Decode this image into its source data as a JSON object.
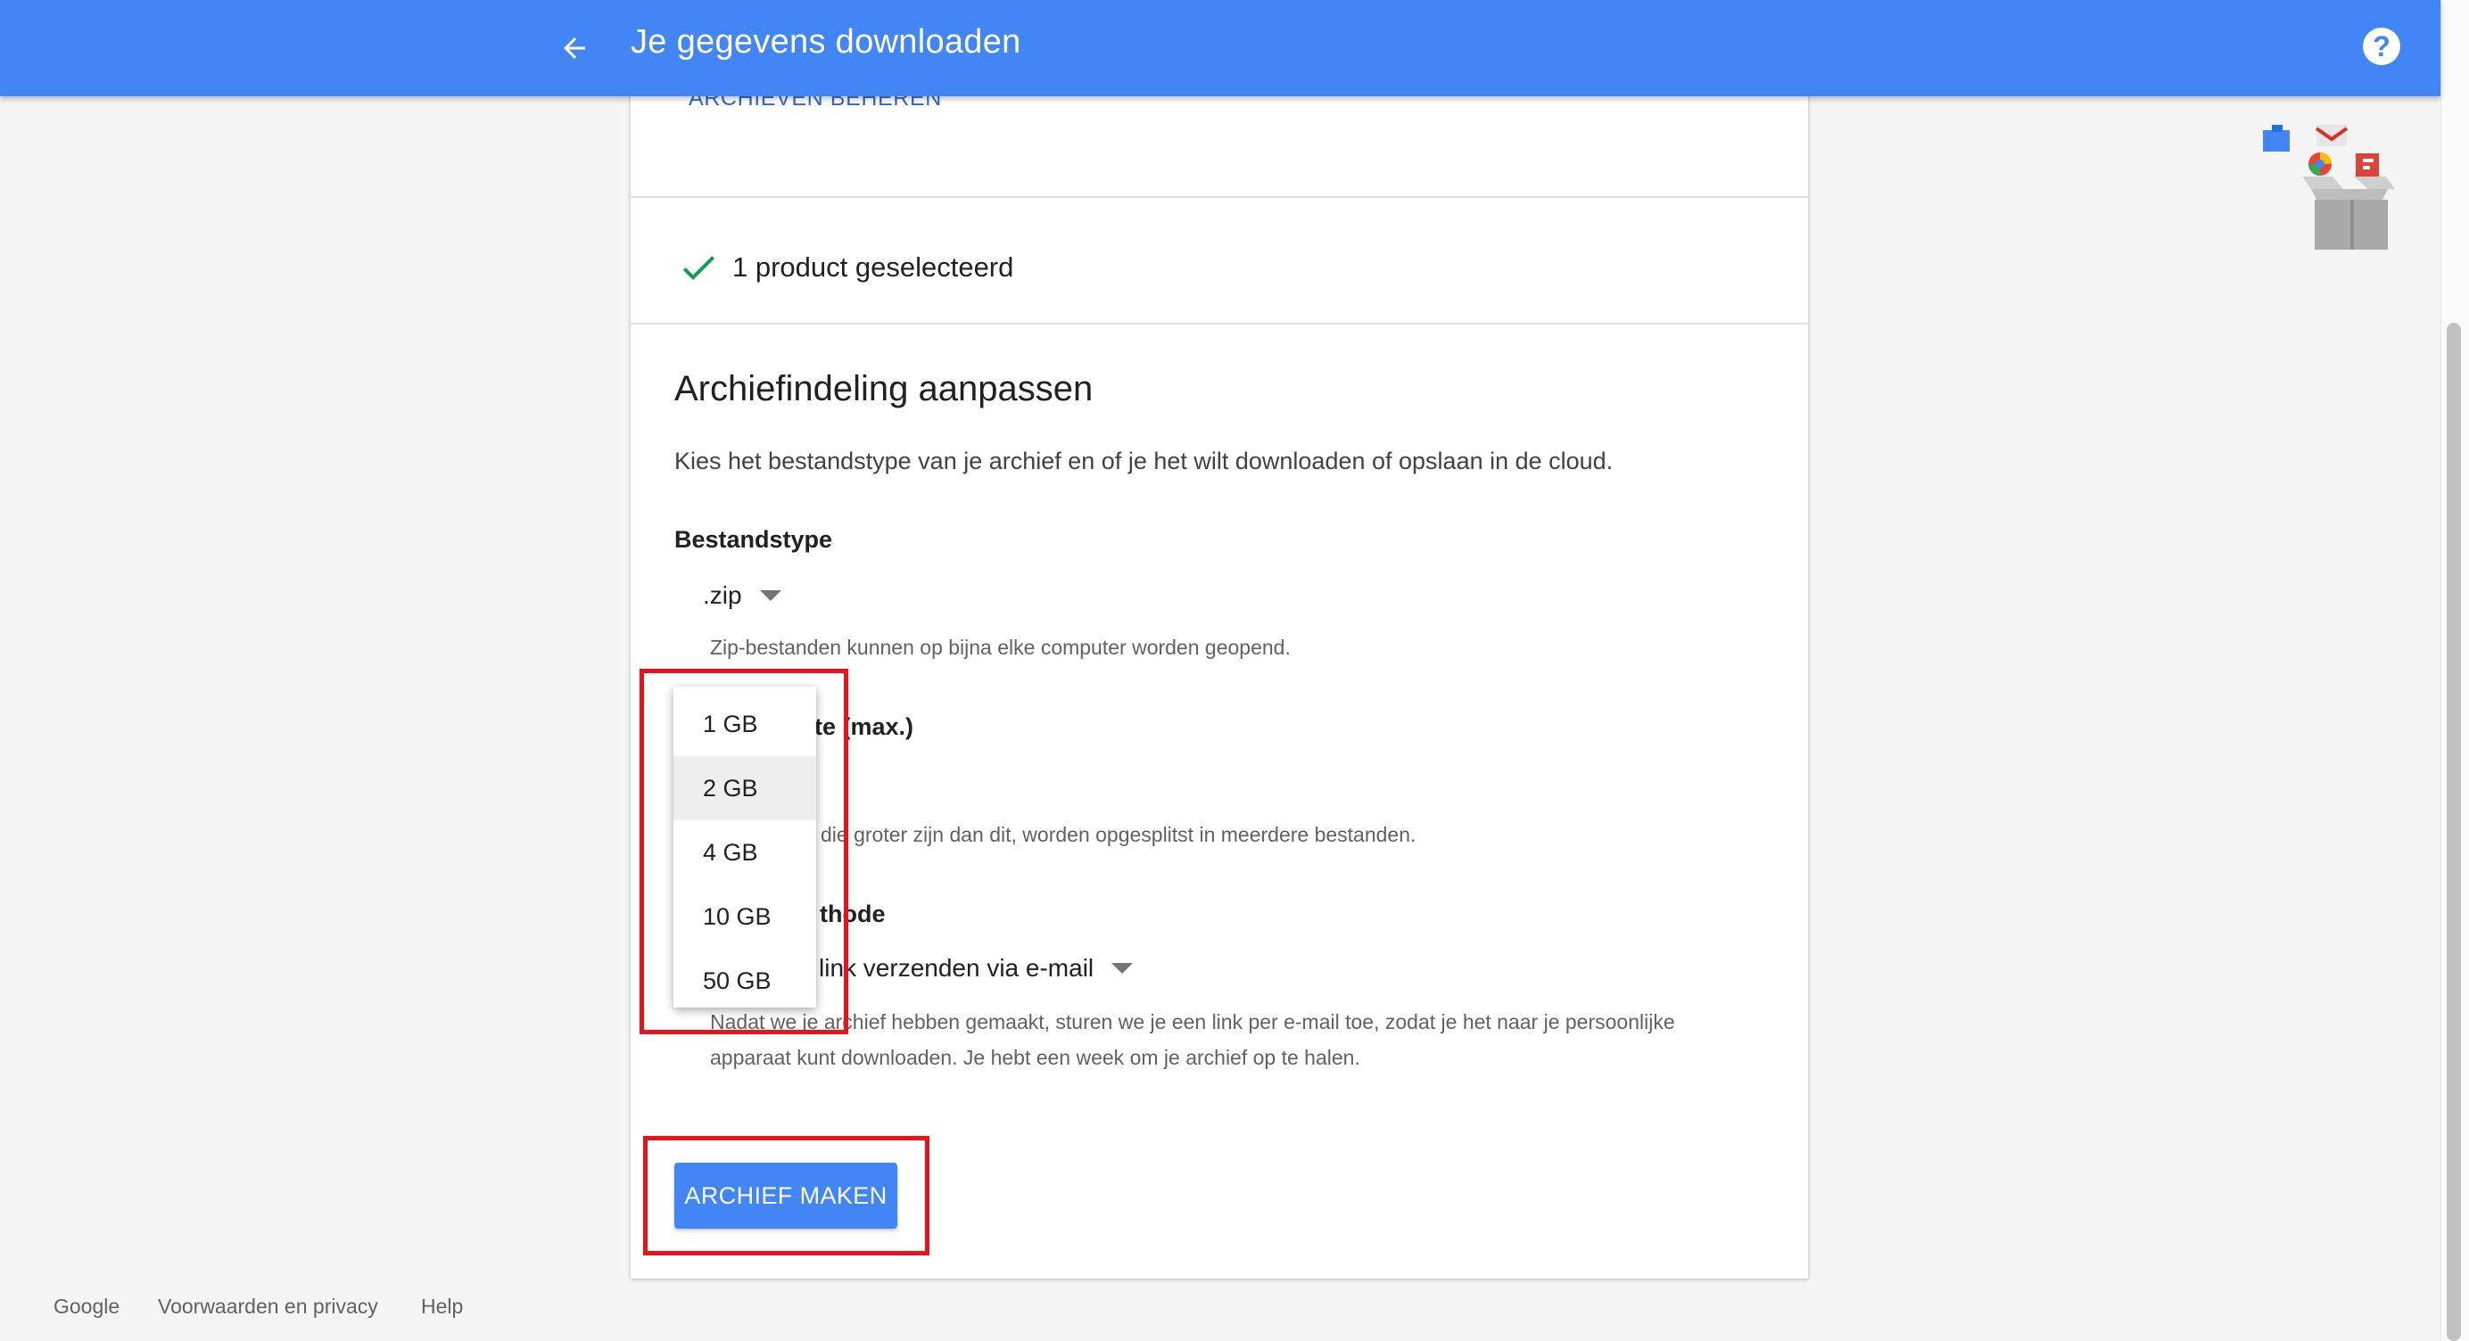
{
  "header": {
    "title": "Je gegevens downloaden",
    "back_icon": "arrow-back-icon",
    "help_icon": "help-icon",
    "help_glyph": "?",
    "background_color": "#4285f4"
  },
  "card": {
    "manage_archives_link": "ARCHIEVEN BEHEREN",
    "selected_products_text": "1 product geselecteerd",
    "section_title": "Archiefindeling aanpassen",
    "section_description": "Kies het bestandstype van je archief en of je het wilt downloaden of opslaan in de cloud.",
    "file_type": {
      "label": "Bestandstype",
      "value": ".zip",
      "helper": "Zip-bestanden kunnen op bijna elke computer worden geopend."
    },
    "archive_size": {
      "label_visible": "te (max.)",
      "helper_visible": "die groter zijn dan dit, worden opgesplitst in meerdere bestanden."
    },
    "delivery_method": {
      "label_visible": "thode",
      "value_visible": "link verzenden via e-mail",
      "helper_line1": "Nadat we je archief hebben gemaakt, sturen we je een link per e-mail toe, zodat je het naar je persoonlijke",
      "helper_line2": "apparaat kunt downloaden. Je hebt een week om je archief op te halen."
    },
    "create_button": "ARCHIEF MAKEN"
  },
  "size_menu": {
    "options": [
      "1 GB",
      "2 GB",
      "4 GB",
      "10 GB",
      "50 GB"
    ],
    "highlighted": "2 GB"
  },
  "footer": {
    "links": [
      "Google",
      "Voorwaarden en privacy",
      "Help"
    ]
  },
  "colors": {
    "accent": "#4285f4",
    "link": "#3367d6",
    "check": "#0f9d58",
    "annotation": "#e8141b"
  }
}
